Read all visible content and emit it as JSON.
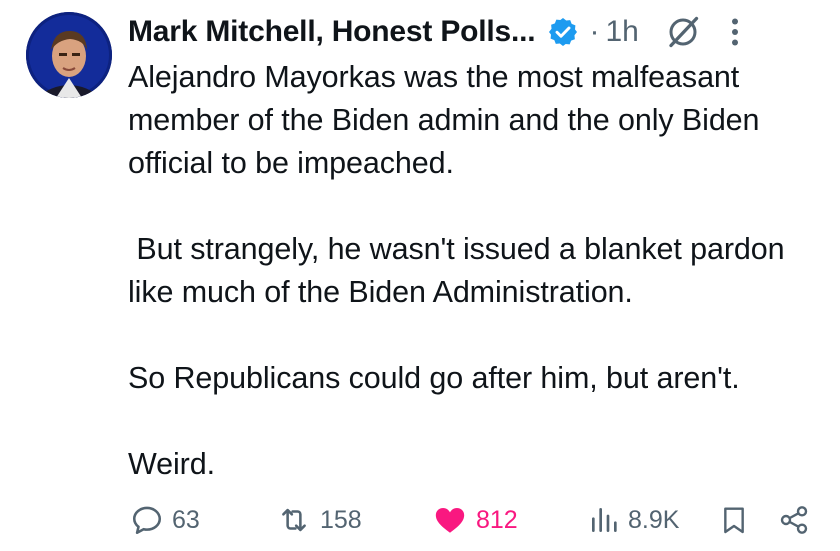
{
  "post": {
    "author_name": "Mark Mitchell, Honest Polls...",
    "verified": true,
    "timestamp": "1h",
    "separator": "·",
    "paragraphs": [
      "Alejandro Mayorkas was the most malfeasant member of the Biden admin and the only Biden official to be impeached.",
      " But strangely, he wasn't issued a blanket pardon like much of the Biden Administration.",
      "So Republicans could go after him, but aren't.",
      "Weird."
    ]
  },
  "actions": {
    "replies": "63",
    "reposts": "158",
    "likes": "812",
    "views": "8.9K"
  },
  "colors": {
    "text": "#0f1419",
    "muted": "#536471",
    "verified_blue": "#1d9bf0",
    "like_pink": "#f91880"
  },
  "icons": [
    "avatar",
    "verified-badge-icon",
    "grok-icon",
    "more-icon",
    "reply-icon",
    "repost-icon",
    "heart-icon",
    "views-icon",
    "bookmark-icon",
    "share-icon"
  ]
}
